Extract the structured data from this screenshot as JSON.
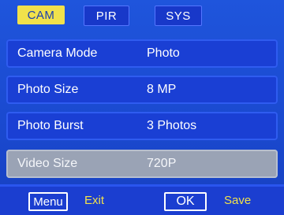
{
  "tabs": [
    {
      "label": "CAM",
      "selected": true
    },
    {
      "label": "PIR",
      "selected": false
    },
    {
      "label": "SYS",
      "selected": false
    }
  ],
  "menu": {
    "items": [
      {
        "label": "Camera Mode",
        "value": "Photo",
        "highlighted": false
      },
      {
        "label": "Photo Size",
        "value": "8 MP",
        "highlighted": false
      },
      {
        "label": "Photo Burst",
        "value": "3 Photos",
        "highlighted": false
      },
      {
        "label": "Video Size",
        "value": "720P",
        "highlighted": true
      }
    ]
  },
  "footer": {
    "menu_key": "Menu",
    "menu_action": "Exit",
    "ok_key": "OK",
    "ok_action": "Save"
  },
  "colors": {
    "background": "#1a49cf",
    "tab_selected": "#f1e14b",
    "row_highlight": "#9aa3b5",
    "hint_text": "#f1e14b"
  }
}
